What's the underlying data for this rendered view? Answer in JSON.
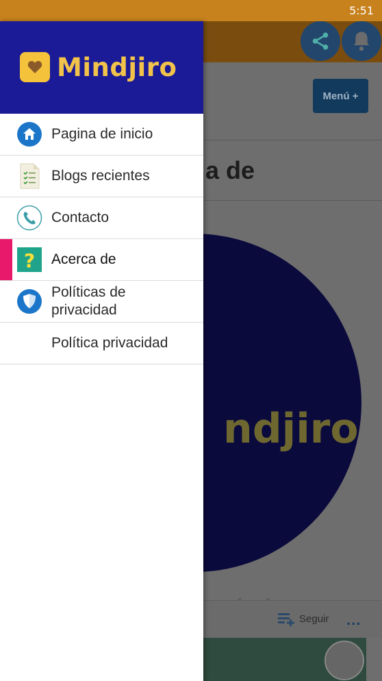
{
  "status_bar": {
    "time": "5:51"
  },
  "background_page": {
    "menu_button_label": "Menú +",
    "title_fragment": "a de",
    "circle_text": "ndjiro",
    "faded_text": "web d",
    "follow_label": "Seguir",
    "more_label": "..."
  },
  "drawer": {
    "logo_text": "Mindjiro",
    "items": [
      {
        "label": "Pagina de inicio",
        "icon": "home-icon"
      },
      {
        "label": "Blogs recientes",
        "icon": "document-list-icon"
      },
      {
        "label": "Contacto",
        "icon": "phone-icon"
      },
      {
        "label": "Acerca de",
        "icon": "question-icon",
        "active": true
      },
      {
        "label": "Políticas de privacidad",
        "icon": "shield-icon"
      },
      {
        "label": "Política privacidad",
        "icon": ""
      }
    ]
  },
  "colors": {
    "status_bar": "#c7821e",
    "drawer_header": "#1b1b98",
    "logo": "#f2c34a",
    "active_marker": "#e8196b"
  }
}
